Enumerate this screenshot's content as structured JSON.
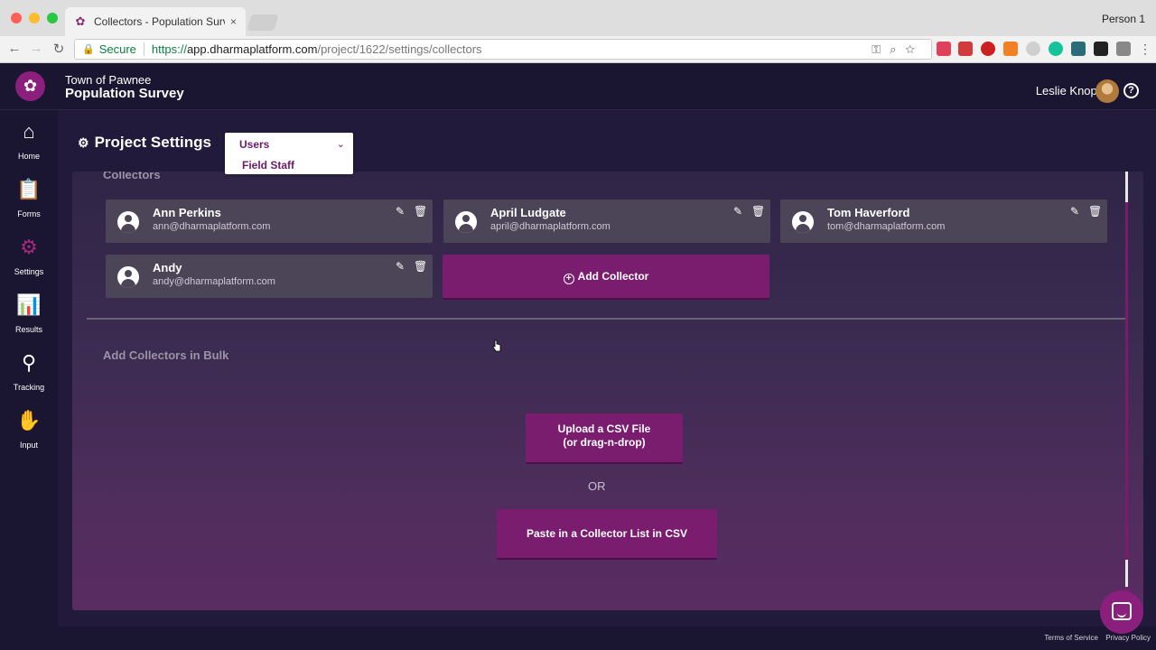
{
  "browser": {
    "tab_title": "Collectors - Population Survey",
    "tab_close": "×",
    "profile": "Person 1",
    "secure_label": "Secure",
    "url_scheme": "https://",
    "url_host": "app.dharmaplatform.com",
    "url_path": "/project/1622/settings/collectors",
    "back_icon": "←",
    "forward_icon": "→",
    "reload_icon": "↻"
  },
  "header": {
    "org": "Town of Pawnee",
    "survey": "Population Survey",
    "user": "Leslie Knope",
    "help": "?"
  },
  "sidebar": {
    "items": [
      {
        "label": "Home",
        "icon": "home-icon"
      },
      {
        "label": "Forms",
        "icon": "clipboard-icon"
      },
      {
        "label": "Settings",
        "icon": "gear-icon"
      },
      {
        "label": "Results",
        "icon": "bar-chart-icon"
      },
      {
        "label": "Tracking",
        "icon": "person-pin-icon"
      },
      {
        "label": "Input",
        "icon": "hand-icon"
      }
    ],
    "active": "Settings"
  },
  "settings": {
    "title": "Project Settings",
    "dropdown": {
      "selected": "Users",
      "option": "Field Staff"
    }
  },
  "collectors": {
    "section_title": "Collectors",
    "items": [
      {
        "name": "Ann Perkins",
        "email": "ann@dharmaplatform.com"
      },
      {
        "name": "April Ludgate",
        "email": "april@dharmaplatform.com"
      },
      {
        "name": "Tom Haverford",
        "email": "tom@dharmaplatform.com"
      },
      {
        "name": "Andy",
        "email": "andy@dharmaplatform.com"
      }
    ],
    "add_button": "Add Collector"
  },
  "bulk": {
    "section_title": "Add Collectors in Bulk",
    "upload_line1": "Upload a CSV File",
    "upload_line2": "(or drag-n-drop)",
    "or": "OR",
    "paste_button": "Paste in a Collector List in CSV"
  },
  "footer": {
    "terms": "Terms of Service",
    "privacy": "Privacy Policy"
  },
  "colors": {
    "brand": "#7a1d6f",
    "background": "#1a1530"
  }
}
